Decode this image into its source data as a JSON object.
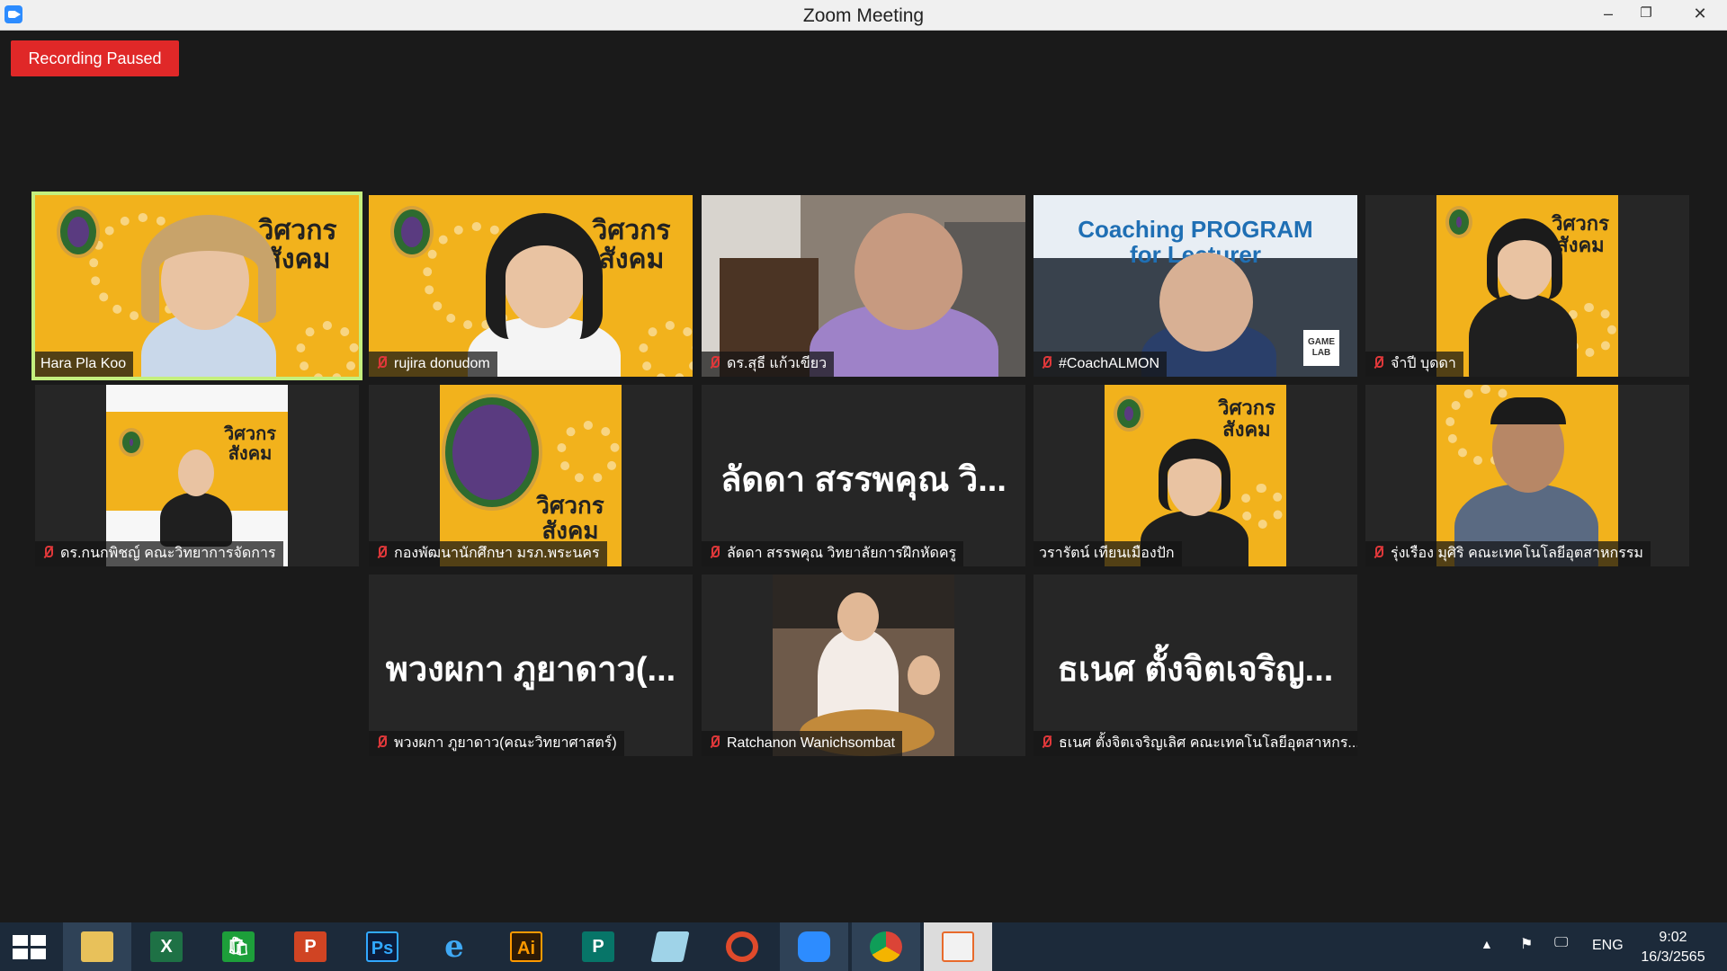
{
  "window": {
    "title": "Zoom Meeting",
    "minimize": "–",
    "maximize": "❐",
    "close": "✕"
  },
  "recording": {
    "label": "Recording Paused"
  },
  "participants": [
    {
      "name": "Hara Pla Koo",
      "muted": false,
      "active": true
    },
    {
      "name": "rujira donudom",
      "muted": true
    },
    {
      "name": "ดร.สุธี แก้วเขียว",
      "muted": true
    },
    {
      "name": "#CoachALMON",
      "muted": true
    },
    {
      "name": "จำปี บุดดา",
      "muted": true
    },
    {
      "name": "ดร.กนกพิชญ์ คณะวิทยาการจัดการ",
      "muted": true
    },
    {
      "name": "กองพัฒนานักศึกษา มรภ.พระนคร",
      "muted": true
    },
    {
      "name": "ลัดดา สรรพคุณ วิทยาลัยการฝึกหัดครู",
      "muted": true,
      "display_name": "ลัดดา สรรพคุณ วิ..."
    },
    {
      "name": "วรารัตน์ เทียนเมืองปัก",
      "muted": false
    },
    {
      "name": "รุ่งเรือง มุศิริ คณะเทคโนโลยีอุตสาหกรรม",
      "muted": true
    },
    {
      "name": "พวงผกา ภูยาดาว(คณะวิทยาศาสตร์)",
      "muted": true,
      "display_name": "พวงผกา ภูยาดาว(..."
    },
    {
      "name": "Ratchanon Wanichsombat",
      "muted": true
    },
    {
      "name": "ธเนศ ตั้งจิตเจริญเลิศ คณะเทคโนโลยีอุตสาหกร...",
      "muted": true,
      "display_name": "ธเนศ ตั้งจิตเจริญ..."
    }
  ],
  "banner": {
    "wisakorn": "วิศวกร",
    "sangkhom": "สังคม",
    "coaching_line1": "Coaching PROGRAM",
    "coaching_line2": "for Lecturer",
    "game_lab": "GAME LAB"
  },
  "taskbar": {
    "apps": [
      {
        "name": "File Explorer",
        "icon": "folder-icon"
      },
      {
        "name": "Excel",
        "icon": "excel-icon",
        "glyph": "X"
      },
      {
        "name": "Store",
        "icon": "store-icon",
        "glyph": "🛍"
      },
      {
        "name": "PowerPoint",
        "icon": "powerpoint-icon",
        "glyph": "P"
      },
      {
        "name": "Photoshop",
        "icon": "photoshop-icon",
        "glyph": "Ps"
      },
      {
        "name": "Internet Explorer",
        "icon": "ie-icon",
        "glyph": "e"
      },
      {
        "name": "Illustrator",
        "icon": "illustrator-icon",
        "glyph": "Ai"
      },
      {
        "name": "Publisher",
        "icon": "publisher-icon",
        "glyph": "P"
      },
      {
        "name": "Notepad",
        "icon": "notepad-icon"
      },
      {
        "name": "PhotoScape",
        "icon": "photoscape-icon"
      },
      {
        "name": "Zoom",
        "icon": "zoom-icon"
      },
      {
        "name": "Chrome",
        "icon": "chrome-icon"
      },
      {
        "name": "Photos",
        "icon": "photos-icon"
      }
    ],
    "language": "ENG",
    "time": "9:02",
    "date": "16/3/2565"
  },
  "colors": {
    "zoom_blue": "#2d8cff",
    "recording_red": "#e02828",
    "active_speaker": "#c4ef7e",
    "brand_yellow": "#f2b21c",
    "taskbar": "#1c2a3a"
  }
}
